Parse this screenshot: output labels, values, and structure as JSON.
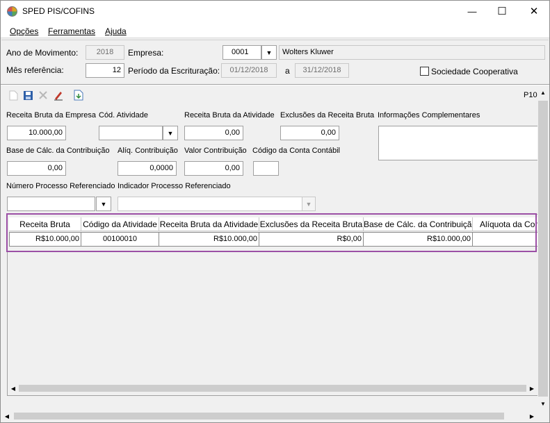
{
  "window": {
    "title": "SPED PIS/COFINS",
    "controls": {
      "minimize": "—",
      "maximize": "☐",
      "close": "✕"
    }
  },
  "menu": [
    {
      "label": "Opções"
    },
    {
      "label": "Ferramentas"
    },
    {
      "label": "Ajuda"
    }
  ],
  "header": {
    "ano_movimento_label": "Ano de Movimento:",
    "ano_movimento_value": "2018",
    "empresa_label": "Empresa:",
    "empresa_code": "0001",
    "empresa_name": "Wolters Kluwer",
    "mes_referencia_label": "Mês referência:",
    "mes_referencia_value": "12",
    "periodo_label": "Período da Escrituração:",
    "periodo_inicio": "01/12/2018",
    "periodo_sep": "a",
    "periodo_fim": "31/12/2018",
    "sociedade_cooperativa_label": "Sociedade Cooperativa",
    "sociedade_cooperativa_checked": false
  },
  "toolbar": {
    "icons": [
      "new-icon",
      "save-icon",
      "delete-icon",
      "edit-icon",
      "export-icon"
    ],
    "right_label": "P10"
  },
  "form": {
    "receita_bruta_empresa_label": "Receita Bruta da Empresa",
    "receita_bruta_empresa_value": "10.000,00",
    "cod_atividade_label": "Cód. Atividade",
    "cod_atividade_value": "",
    "receita_bruta_atividade_label": "Receita Bruta da Atividade",
    "receita_bruta_atividade_value": "0,00",
    "exclusoes_label": "Exclusões da Receita Bruta",
    "exclusoes_value": "0,00",
    "info_complementares_label": "Informações Complementares",
    "info_complementares_value": "",
    "base_calc_label": "Base de Cálc. da Contribuição",
    "base_calc_value": "0,00",
    "aliq_label": "Alíq. Contribuição",
    "aliq_value": "0,0000",
    "valor_contribuicao_label": "Valor Contribuição",
    "valor_contribuicao_value": "0,00",
    "codigo_conta_label": "Código da Conta Contábil",
    "codigo_conta_value": "",
    "numero_processo_label": "Número Processo Referenciado",
    "numero_processo_value": "",
    "indicador_processo_label": "Indicador Processo Referenciado",
    "indicador_processo_value": ""
  },
  "grid": {
    "columns": [
      "Receita Bruta",
      "Código da Atividade",
      "Receita Bruta da Atividade",
      "Exclusões da Receita Bruta",
      "Base de Cálc. da Contribuição",
      "Alíquota da Contr"
    ],
    "rows": [
      [
        "R$10.000,00",
        "00100010",
        "R$10.000,00",
        "R$0,00",
        "R$10.000,00",
        ""
      ]
    ]
  }
}
